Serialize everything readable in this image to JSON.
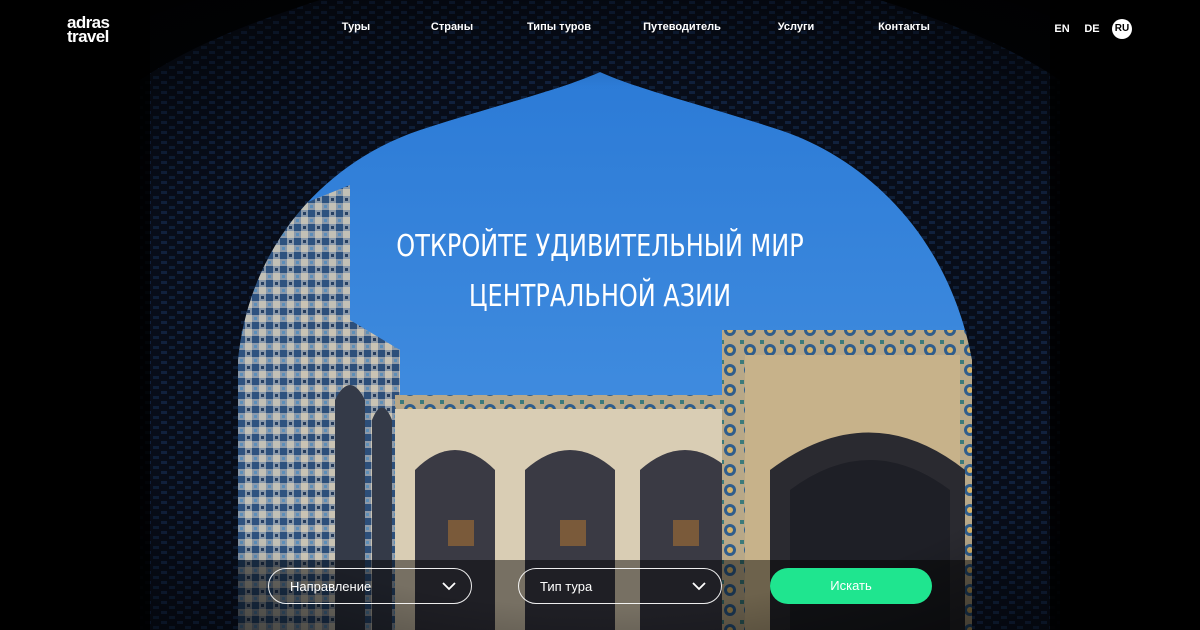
{
  "brand": {
    "logo_line1": "adras",
    "logo_line2": "travel"
  },
  "nav": {
    "items": [
      {
        "label": "Туры"
      },
      {
        "label": "Страны"
      },
      {
        "label": "Типы туров"
      },
      {
        "label": "Путеводитель"
      },
      {
        "label": "Услуги"
      },
      {
        "label": "Контакты"
      }
    ]
  },
  "languages": {
    "en": "EN",
    "de": "DE",
    "ru": "RU",
    "active": "RU"
  },
  "hero": {
    "headline_line1": "ОТКРОЙТЕ УДИВИТЕЛЬНЫЙ МИР",
    "headline_line2": "ЦЕНТРАЛЬНОЙ АЗИИ"
  },
  "search": {
    "direction_label": "Направление",
    "tour_type_label": "Тип тура",
    "submit_label": "Искать"
  },
  "colors": {
    "accent": "#1fe58f",
    "sky": "#3a85d6",
    "background": "#000000"
  }
}
